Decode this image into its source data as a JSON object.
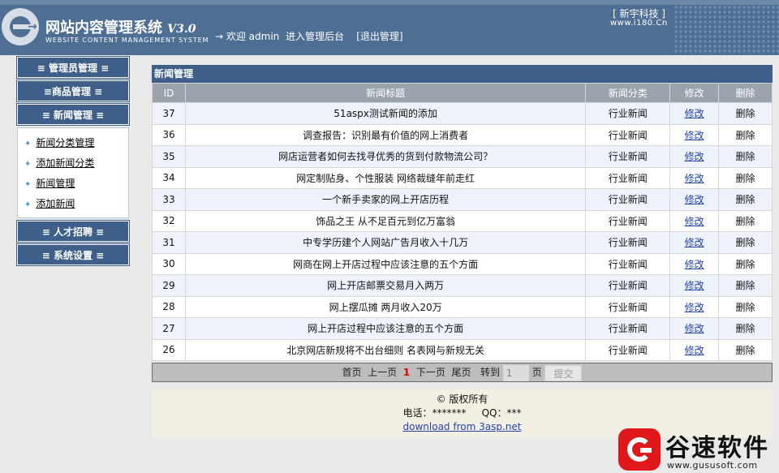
{
  "header": {
    "title": "网站内容管理系统",
    "version": "V3.0",
    "subtitle": "WEBSITE CONTENT MANAGEMENT SYSTEM",
    "welcome_prefix": "→ 欢迎 admin",
    "enter_admin": "进入管理后台",
    "logout": "[退出管理]",
    "brand": "[ 新宇科技 ]",
    "brand_url": "www.i180.Cn"
  },
  "sidebar": {
    "sections": [
      {
        "label": "≡ 管理员管理 ≡"
      },
      {
        "label": "≡商品管理 ≡"
      },
      {
        "label": "≡ 新闻管理 ≡"
      },
      {
        "label": "≡ 人才招聘 ≡"
      },
      {
        "label": "≡ 系统设置 ≡"
      }
    ],
    "news_items": [
      {
        "label": "新闻分类管理"
      },
      {
        "label": "添加新闻分类"
      },
      {
        "label": "新闻管理"
      },
      {
        "label": "添加新闻"
      }
    ]
  },
  "main": {
    "panel_title": "新闻管理",
    "columns": [
      "ID",
      "新闻标题",
      "新闻分类",
      "修改",
      "删除"
    ],
    "rows": [
      {
        "id": "37",
        "title": "51aspx测试新闻的添加",
        "category": "行业新闻",
        "edit": "修改",
        "delete": "删除"
      },
      {
        "id": "36",
        "title": "调查报告：识别最有价值的网上消费者",
        "category": "行业新闻",
        "edit": "修改",
        "delete": "删除"
      },
      {
        "id": "35",
        "title": "网店运营者如何去找寻优秀的货到付款物流公司？",
        "category": "行业新闻",
        "edit": "修改",
        "delete": "删除"
      },
      {
        "id": "34",
        "title": "网定制贴身、个性服装 网络裁缝年前走红",
        "category": "行业新闻",
        "edit": "修改",
        "delete": "删除"
      },
      {
        "id": "33",
        "title": "一个新手卖家的网上开店历程",
        "category": "行业新闻",
        "edit": "修改",
        "delete": "删除"
      },
      {
        "id": "32",
        "title": "饰品之王 从不足百元到亿万富翁",
        "category": "行业新闻",
        "edit": "修改",
        "delete": "删除"
      },
      {
        "id": "31",
        "title": "中专学历建个人网站广告月收入十几万",
        "category": "行业新闻",
        "edit": "修改",
        "delete": "删除"
      },
      {
        "id": "30",
        "title": "网商在网上开店过程中应该注意的五个方面",
        "category": "行业新闻",
        "edit": "修改",
        "delete": "删除"
      },
      {
        "id": "29",
        "title": "网上开店邮票交易月入两万",
        "category": "行业新闻",
        "edit": "修改",
        "delete": "删除"
      },
      {
        "id": "28",
        "title": "网上摆瓜摊 两月收入20万",
        "category": "行业新闻",
        "edit": "修改",
        "delete": "删除"
      },
      {
        "id": "27",
        "title": "网上开店过程中应该注意的五个方面",
        "category": "行业新闻",
        "edit": "修改",
        "delete": "删除"
      },
      {
        "id": "26",
        "title": "北京网店新规将不出台细则 名表网与新规无关",
        "category": "行业新闻",
        "edit": "修改",
        "delete": "删除"
      }
    ]
  },
  "pager": {
    "first": "首页",
    "prev": "上一页",
    "current": "1",
    "next": "下一页",
    "last": "尾页",
    "goto_label": "转到",
    "goto_value": "1",
    "page_unit": "页",
    "submit": "提交"
  },
  "footer": {
    "copyright": "© 版权所有",
    "contact": "电话：*******     QQ：***",
    "download_link": "download from 3asp.net"
  },
  "watermark": {
    "text": "谷速软件",
    "url": "www.gususoft.com"
  }
}
